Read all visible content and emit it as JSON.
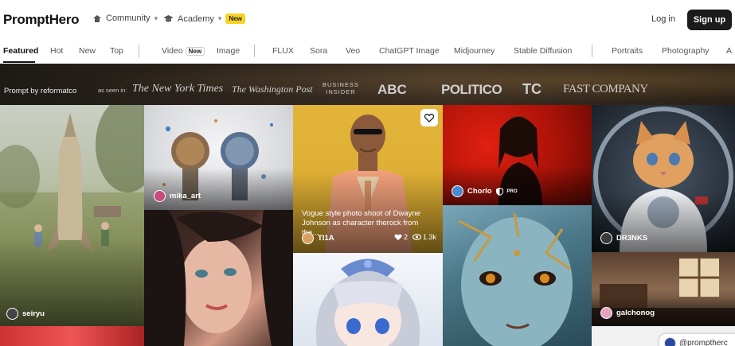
{
  "header": {
    "logo": "PromptHero",
    "community_label": "Community",
    "academy_label": "Academy",
    "academy_badge": "New",
    "login_label": "Log in",
    "signup_label": "Sign up"
  },
  "tabs": [
    {
      "label": "Featured",
      "active": true
    },
    {
      "label": "Hot"
    },
    {
      "label": "New"
    },
    {
      "label": "Top"
    },
    {
      "label": "Video",
      "badge": "New"
    },
    {
      "label": "Image"
    },
    {
      "label": "FLUX"
    },
    {
      "label": "Sora"
    },
    {
      "label": "Veo"
    },
    {
      "label": "ChatGPT Image"
    },
    {
      "label": "Midjourney"
    },
    {
      "label": "Stable Diffusion"
    },
    {
      "label": "Portraits"
    },
    {
      "label": "Photography"
    },
    {
      "label": "A"
    }
  ],
  "banner": {
    "prompt_by": "Prompt by reformatco",
    "as_seen_in": "as seen in:",
    "press": {
      "nyt": "The New York Times",
      "wp": "The Washington Post",
      "bi_line1": "BUSINESS",
      "bi_line2": "INSIDER",
      "abc": "ABC",
      "politico": "POLITICO",
      "tc": "TC",
      "fastco": "FAST COMPANY"
    }
  },
  "cards": {
    "rocket": {
      "author": "seiryu"
    },
    "robots": {
      "author": "mika_art"
    },
    "rock": {
      "author": "TI1A",
      "caption": "Vogue style photo shoot of Dwayne Johnson as character therock from the...",
      "likes": "2",
      "views": "1.3k"
    },
    "red_woman": {
      "author": "Chorlo",
      "badge": "PRO"
    },
    "cat": {
      "author": "DR3NKS"
    },
    "room": {
      "author": "galchonog"
    }
  },
  "footer_pill": "@promptherc",
  "colors": {
    "accent_badge": "#f5d320",
    "signup_bg": "#1b1b1b"
  }
}
